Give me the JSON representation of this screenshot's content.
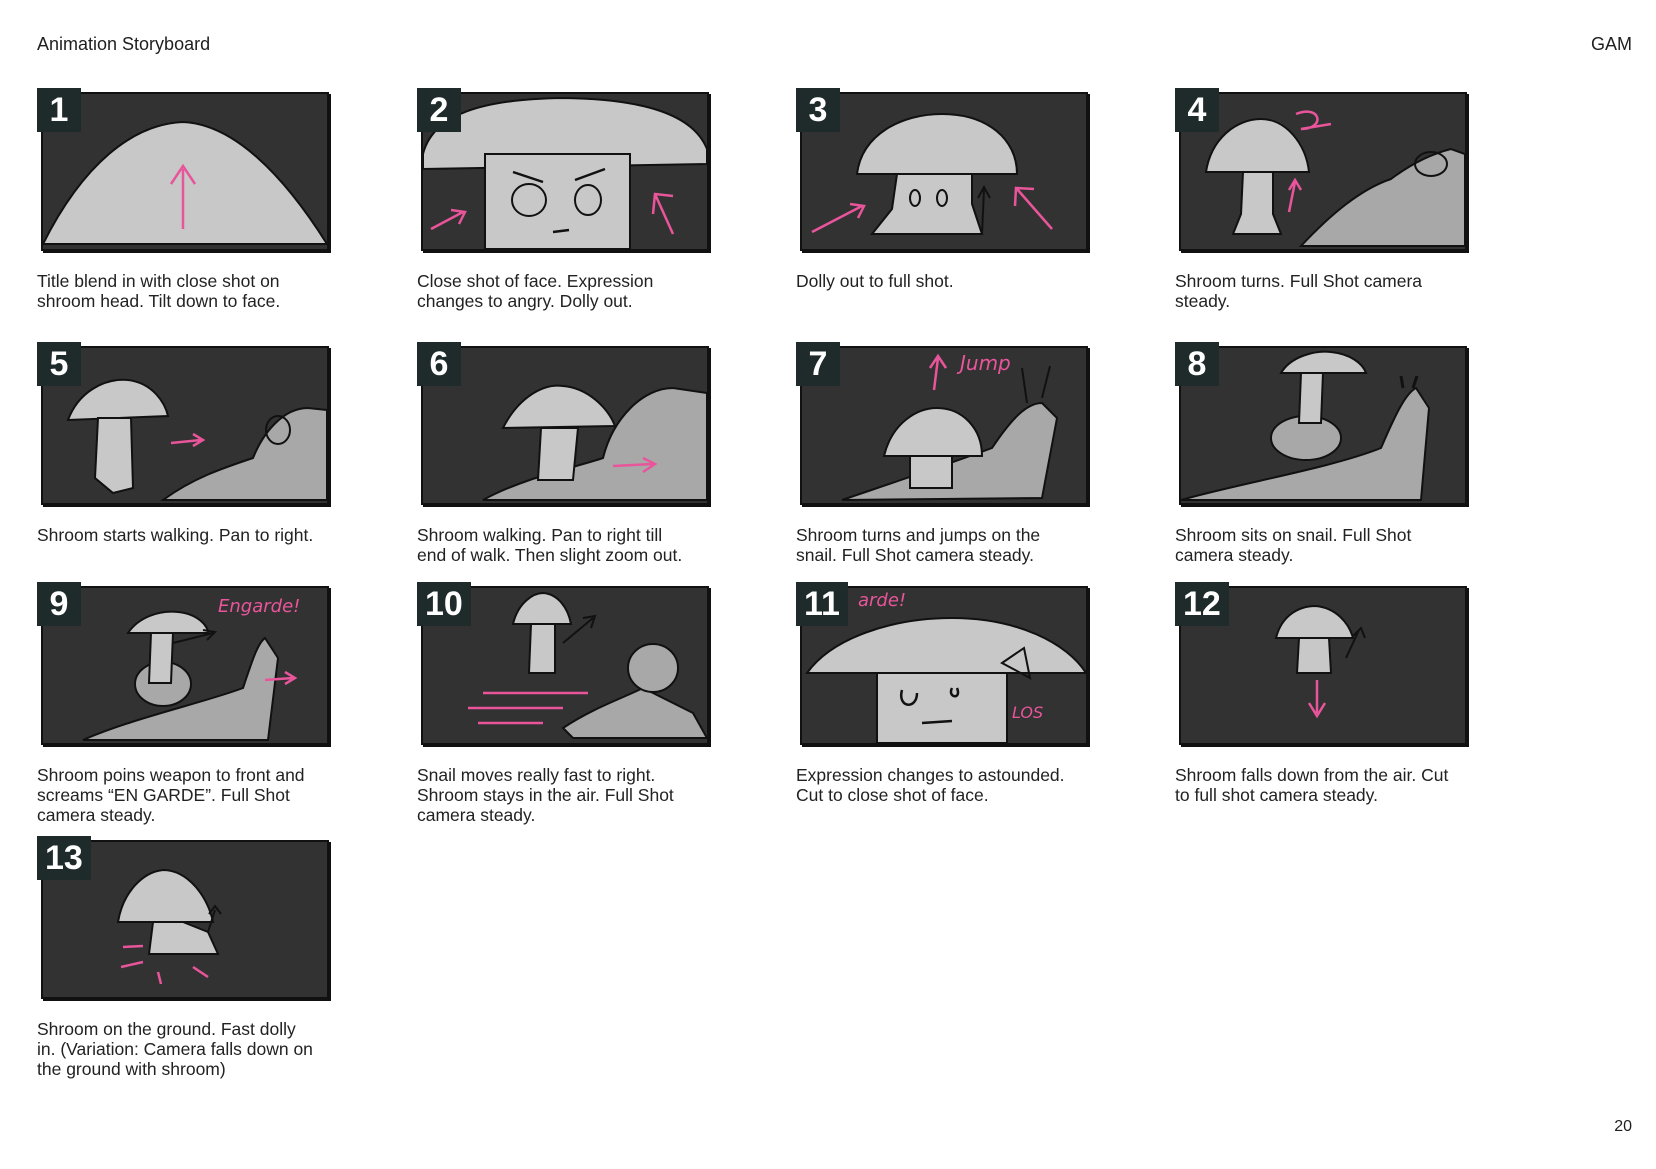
{
  "header": {
    "title": "Animation Storyboard",
    "code": "GAM"
  },
  "page_number": "20",
  "colors": {
    "frame": "#323232",
    "badge": "#1f2a2a",
    "sketch": "#c8c8c8",
    "accent": "#e8559a"
  },
  "panels": [
    {
      "number": "1",
      "caption": "Title blend in with close shot on\nshroom head. Tilt down to face."
    },
    {
      "number": "2",
      "caption": "Close shot of face. Expression\nchanges to angry. Dolly out."
    },
    {
      "number": "3",
      "caption": "Dolly out to full shot."
    },
    {
      "number": "4",
      "caption": "Shroom turns.  Full Shot camera\nsteady."
    },
    {
      "number": "5",
      "caption": "Shroom starts walking. Pan to right."
    },
    {
      "number": "6",
      "caption": "Shroom walking. Pan to right till\nend of walk. Then slight zoom out."
    },
    {
      "number": "7",
      "caption": "Shroom turns and jumps on the\nsnail.  Full Shot camera steady."
    },
    {
      "number": "8",
      "caption": "Shroom sits on snail. Full Shot\ncamera steady."
    },
    {
      "number": "9",
      "caption": "Shroom poins weapon to front and\nscreams “EN GARDE”. Full Shot\ncamera steady."
    },
    {
      "number": "10",
      "caption": "Snail moves really fast to right.\nShroom stays in the air. Full Shot\ncamera steady."
    },
    {
      "number": "11",
      "caption": "Expression changes to astounded.\nCut to close shot of face."
    },
    {
      "number": "12",
      "caption": "Shroom falls down from the air. Cut\nto full shot camera steady."
    },
    {
      "number": "13",
      "caption": "Shroom on the ground. Fast dolly\nin. (Variation: Camera falls down on\nthe ground with shroom)"
    }
  ],
  "sketch_text": {
    "p7": "Jump",
    "p9": "Engarde!",
    "p11_top": "arde!",
    "p11_side": "LOS"
  }
}
